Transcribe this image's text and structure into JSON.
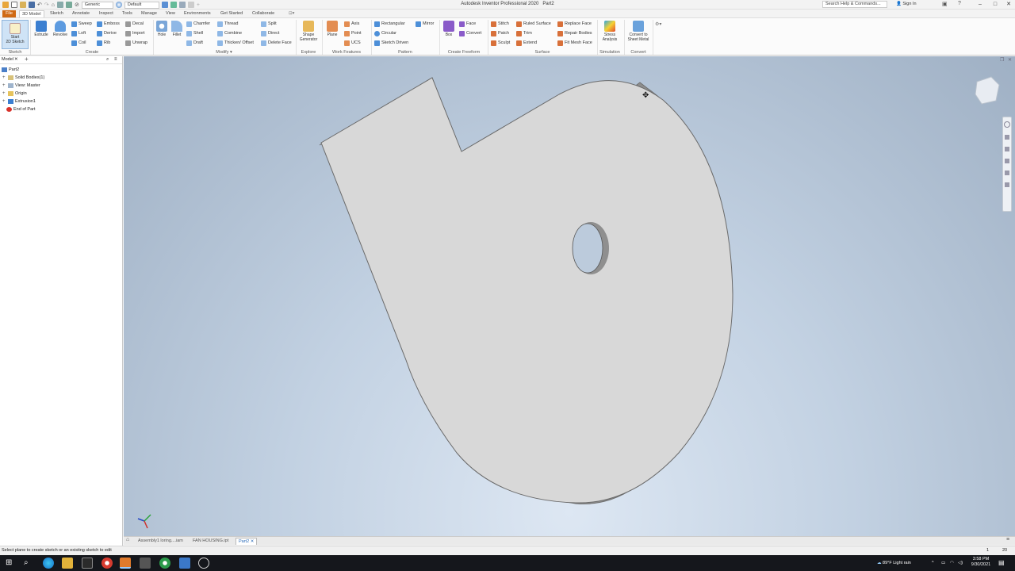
{
  "window": {
    "app_title": "Autodesk Inventor Professional 2020",
    "doc_title": "Part2",
    "search_placeholder": "Search Help & Commands...",
    "sign_in": "Sign In"
  },
  "quick_access": {
    "material": "Generic",
    "appearance": "Default"
  },
  "ribbon_tabs": [
    {
      "label": "File"
    },
    {
      "label": "3D Model"
    },
    {
      "label": "Sketch"
    },
    {
      "label": "Annotate"
    },
    {
      "label": "Inspect"
    },
    {
      "label": "Tools"
    },
    {
      "label": "Manage"
    },
    {
      "label": "View"
    },
    {
      "label": "Environments"
    },
    {
      "label": "Get Started"
    },
    {
      "label": "Collaborate"
    }
  ],
  "ribbon": {
    "sketch": {
      "start_line1": "Start",
      "start_line2": "2D Sketch",
      "panel": "Sketch"
    },
    "create": {
      "extrude": "Extrude",
      "revolve": "Revolve",
      "sweep": "Sweep",
      "loft": "Loft",
      "coil": "Coil",
      "emboss": "Emboss",
      "derive": "Derive",
      "rib": "Rib",
      "decal": "Decal",
      "import": "Import",
      "unwrap": "Unwrap",
      "panel": "Create"
    },
    "modify": {
      "hole": "Hole",
      "fillet": "Fillet",
      "chamfer": "Chamfer",
      "shell": "Shell",
      "draft": "Draft",
      "thread": "Thread",
      "combine": "Combine",
      "thicken": "Thicken/ Offset",
      "split": "Split",
      "direct": "Direct",
      "delete_face": "Delete Face",
      "panel": "Modify"
    },
    "explore": {
      "shape_gen_1": "Shape",
      "shape_gen_2": "Generator",
      "panel": "Explore"
    },
    "work": {
      "plane": "Plane",
      "axis": "Axis",
      "point": "Point",
      "ucs": "UCS",
      "panel": "Work Features"
    },
    "pattern": {
      "rectangular": "Rectangular",
      "circular": "Circular",
      "sketch_driven": "Sketch Driven",
      "mirror": "Mirror",
      "panel": "Pattern"
    },
    "freeform": {
      "box": "Box",
      "face": "Face",
      "convert": "Convert",
      "panel": "Create Freeform"
    },
    "surface": {
      "stitch": "Stitch",
      "patch": "Patch",
      "sculpt": "Sculpt",
      "ruled": "Ruled Surface",
      "trim": "Trim",
      "extend": "Extend",
      "replace": "Replace Face",
      "repair": "Repair Bodies",
      "fit_mesh": "Fit Mesh Face",
      "panel": "Surface"
    },
    "simulation": {
      "stress_1": "Stress",
      "stress_2": "Analysis",
      "panel": "Simulation"
    },
    "convert": {
      "sheet_1": "Convert to",
      "sheet_2": "Sheet Metal",
      "panel": "Convert"
    }
  },
  "browser": {
    "tab": "Model",
    "items": [
      {
        "label": "Part2"
      },
      {
        "label": "Solid Bodies(1)"
      },
      {
        "label": "View: Master"
      },
      {
        "label": "Origin"
      },
      {
        "label": "Extrusion1"
      },
      {
        "label": "End of Part"
      }
    ]
  },
  "doc_tabs": [
    {
      "label": "Assembly1 loring....iam"
    },
    {
      "label": "FAN HOUSING.ipt"
    },
    {
      "label": "Part2"
    }
  ],
  "status": {
    "message": "Select plane to create sketch or an existing sketch to edit",
    "count_a": "1",
    "count_b": "20"
  },
  "taskbar": {
    "weather": "89°F  Light rain",
    "time": "3:58 PM",
    "date": "9/30/2021"
  }
}
